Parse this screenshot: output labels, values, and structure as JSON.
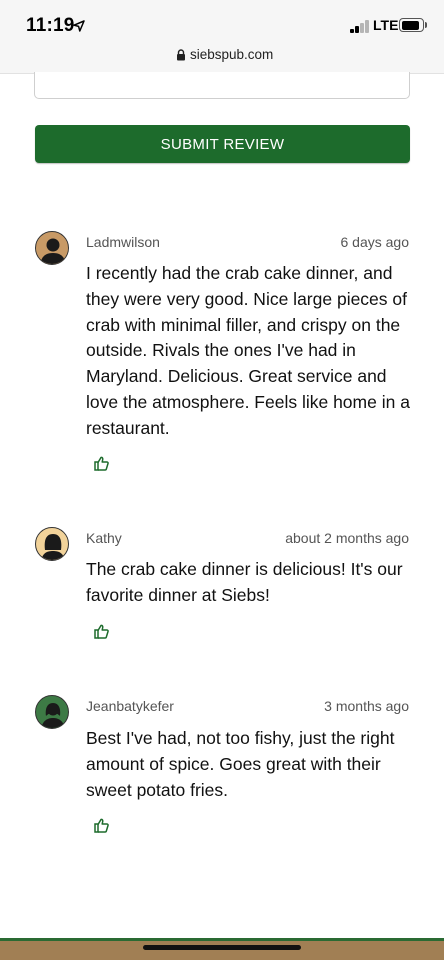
{
  "status_bar": {
    "time": "11:19",
    "network": "LTE",
    "icons": [
      "location-arrow-icon",
      "signal-icon",
      "battery-icon"
    ]
  },
  "browser": {
    "domain": "siebspub.com",
    "icons": [
      "lock-icon"
    ]
  },
  "form": {
    "submit_label": "SUBMIT REVIEW",
    "accent_color": "#1d6b2c"
  },
  "reviews": [
    {
      "name": "Ladmwilson",
      "time_ago": "6 days ago",
      "avatar_icon": "person-avatar-icon",
      "avatar_color": "#c89a66",
      "body": "I recently had the crab cake dinner, and they were very good. Nice large pieces of crab with minimal filler, and crispy on the outside. Rivals the ones I've had in Maryland. Delicious. Great service and love the atmosphere. Feels like home in a restaurant."
    },
    {
      "name": "Kathy",
      "time_ago": "about 2 months ago",
      "avatar_icon": "person-avatar-icon",
      "avatar_color": "#f2d39a",
      "body": "The crab cake dinner is delicious! It's our favorite dinner at Siebs!"
    },
    {
      "name": "Jeanbatykefer",
      "time_ago": "3 months ago",
      "avatar_icon": "person-avatar-icon",
      "avatar_color": "#3d7a45",
      "body": "Best I've had, not too fishy, just the right amount of spice. Goes great with their sweet potato fries."
    }
  ],
  "like_icon": "thumbs-up-icon"
}
